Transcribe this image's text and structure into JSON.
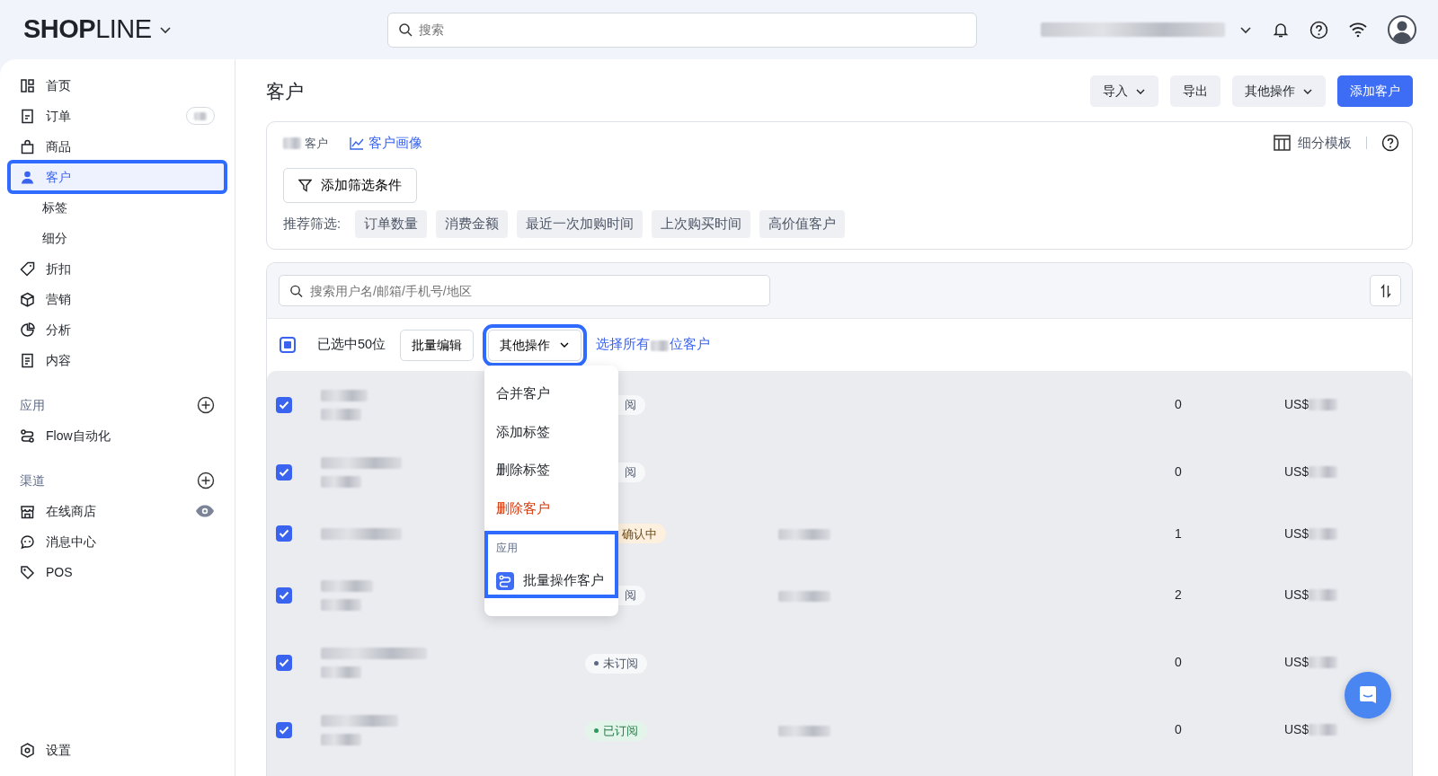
{
  "header": {
    "logo": "**SHOP**LINE",
    "search_placeholder": "搜索"
  },
  "sidebar": {
    "items": [
      {
        "kind": "nav",
        "label": "首页",
        "selected": false,
        "highlighted": false,
        "has_count": false,
        "has_preview": false
      },
      {
        "kind": "nav",
        "label": "订单",
        "selected": false,
        "highlighted": false,
        "has_count": true,
        "has_preview": false
      },
      {
        "kind": "nav",
        "label": "商品",
        "selected": false,
        "highlighted": false,
        "has_count": false,
        "has_preview": false
      },
      {
        "kind": "nav",
        "label": "客户",
        "selected": true,
        "highlighted": true,
        "has_count": false,
        "has_preview": false
      },
      {
        "kind": "sub",
        "label": "标签",
        "selected": false
      },
      {
        "kind": "sub",
        "label": "细分",
        "selected": false
      },
      {
        "kind": "nav",
        "label": "折扣",
        "selected": false,
        "highlighted": false,
        "has_count": false,
        "has_preview": false
      },
      {
        "kind": "nav",
        "label": "营销",
        "selected": false,
        "highlighted": false,
        "has_count": false,
        "has_preview": false
      },
      {
        "kind": "nav",
        "label": "分析",
        "selected": false,
        "highlighted": false,
        "has_count": false,
        "has_preview": false
      },
      {
        "kind": "nav",
        "label": "内容",
        "selected": false,
        "highlighted": false,
        "has_count": false,
        "has_preview": false
      },
      {
        "kind": "section",
        "label": "应用"
      },
      {
        "kind": "nav",
        "label": "Flow自动化",
        "selected": false,
        "highlighted": false,
        "has_count": false,
        "has_preview": false
      },
      {
        "kind": "section",
        "label": "渠道"
      },
      {
        "kind": "nav",
        "label": "在线商店",
        "selected": false,
        "highlighted": false,
        "has_count": false,
        "has_preview": true
      },
      {
        "kind": "nav",
        "label": "消息中心",
        "selected": false,
        "highlighted": false,
        "has_count": false,
        "has_preview": false
      },
      {
        "kind": "nav",
        "label": "POS",
        "selected": false,
        "highlighted": false,
        "has_count": false,
        "has_preview": false
      }
    ],
    "footer_item": {
      "label": "设置",
      "selected": false
    }
  },
  "page": {
    "title": "客户",
    "actions": [
      {
        "label": "导入",
        "kind": "dropdown"
      },
      {
        "label": "导出",
        "kind": "plain"
      },
      {
        "label": "其他操作",
        "kind": "dropdown"
      },
      {
        "label": "添加客户",
        "kind": "primary"
      }
    ]
  },
  "filter_card": {
    "count_label": "客户",
    "portrait_link": "客户画像",
    "template_label": "细分模板",
    "add_filter": "添加筛选条件",
    "recommend_label": "推荐筛选:",
    "chips": [
      "订单数量",
      "消费金额",
      "最近一次加购时间",
      "上次购买时间",
      "高价值客户"
    ]
  },
  "table": {
    "search_placeholder": "搜索用户名/邮箱/手机号/地区",
    "toolbar": {
      "indeterminate": true,
      "selected_text": "已选中50位",
      "bulk_edit": "批量编辑",
      "more": "其他操作",
      "more_highlighted": true,
      "select_all": [
        "选择所有",
        "位客户"
      ]
    },
    "rows": [
      {
        "checked": true,
        "two_line_name": true,
        "status": {
          "text": "阅",
          "kind": "neutral",
          "dot": false
        },
        "has_email": false,
        "orders": "0",
        "spend": "US$"
      },
      {
        "checked": true,
        "two_line_name": true,
        "status": {
          "text": "阅",
          "kind": "neutral",
          "dot": false
        },
        "has_email": false,
        "orders": "0",
        "spend": "US$"
      },
      {
        "checked": true,
        "two_line_name": false,
        "status": {
          "text": "确认中",
          "kind": "warning",
          "dot": false
        },
        "has_email": true,
        "orders": "1",
        "spend": "US$"
      },
      {
        "checked": true,
        "two_line_name": true,
        "status": {
          "text": "阅",
          "kind": "neutral",
          "dot": false
        },
        "has_email": true,
        "orders": "2",
        "spend": "US$"
      },
      {
        "checked": true,
        "two_line_name": true,
        "status": {
          "text": "未订阅",
          "kind": "neutral",
          "dot": true
        },
        "has_email": false,
        "orders": "0",
        "spend": "US$"
      },
      {
        "checked": true,
        "two_line_name": true,
        "status": {
          "text": "已订阅",
          "kind": "success",
          "dot": true
        },
        "has_email": true,
        "orders": "0",
        "spend": "US$"
      }
    ],
    "menu": {
      "items": [
        {
          "label": "合并客户",
          "kind": "normal"
        },
        {
          "label": "添加标签",
          "kind": "normal"
        },
        {
          "label": "删除标签",
          "kind": "normal"
        },
        {
          "label": "删除客户",
          "kind": "danger"
        }
      ],
      "section": {
        "title": "应用",
        "highlighted": true,
        "items": [
          {
            "label": "批量操作客户"
          }
        ]
      }
    }
  }
}
